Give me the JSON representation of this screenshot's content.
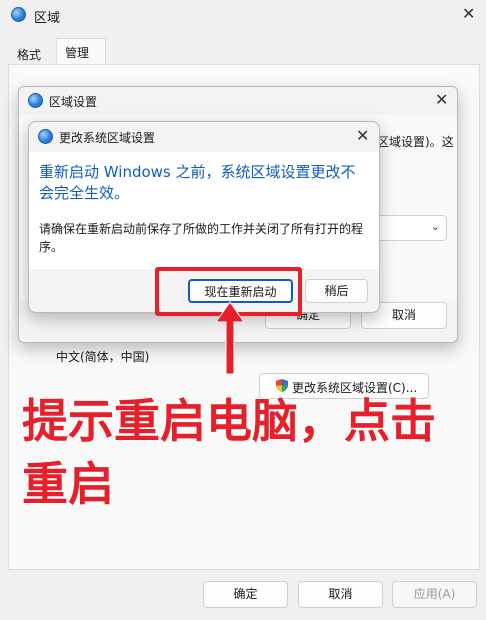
{
  "main_window": {
    "title": "区域",
    "tabs": [
      {
        "label": "格式"
      },
      {
        "label": "管理"
      }
    ],
    "current_locale": "中文(简体，中国)",
    "change_locale_button": "更改系统区域设置(C)...",
    "buttons": {
      "ok": "确定",
      "cancel": "取消",
      "apply": "应用(A)"
    }
  },
  "region_settings_dialog": {
    "title": "区域设置",
    "partial_text": "区域设置)。这",
    "buttons": {
      "ok": "确定",
      "cancel": "取消"
    }
  },
  "change_locale_dialog": {
    "title": "更改系统区域设置",
    "headline": "重新启动 Windows 之前，系统区域设置更改不会完全生效。",
    "message": "请确保在重新启动前保存了所做的工作并关闭了所有打开的程序。",
    "restart_button": "现在重新启动",
    "later_button": "稍后"
  },
  "annotation": {
    "text_line1": "提示重启电脑，点击",
    "text_line2": "重启",
    "color": "#e5202a"
  },
  "colors": {
    "accent_blue": "#0f5db8",
    "annotation_red": "#e5202a"
  }
}
